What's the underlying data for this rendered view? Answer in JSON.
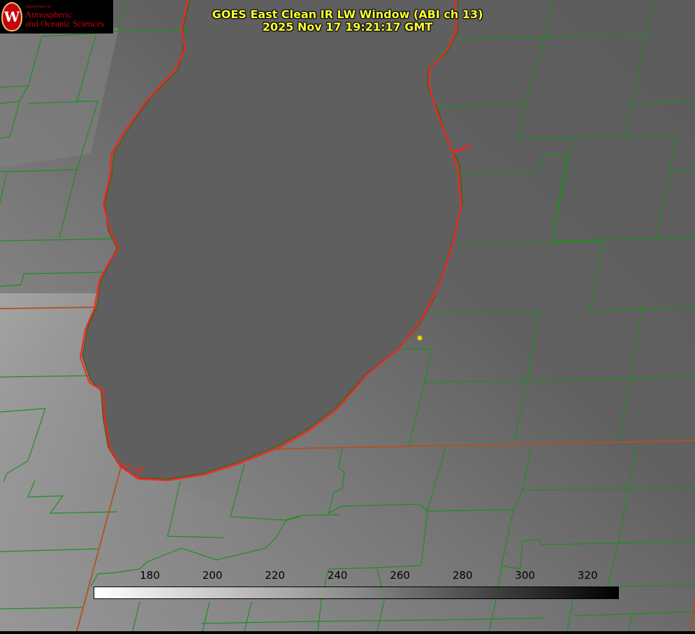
{
  "title": {
    "line1": "GOES East Clean IR LW Window (ABI ch 13)",
    "line2": "2025 Nov 17 19:21:17 GMT"
  },
  "logo": {
    "letter": "W",
    "dept": "Department of",
    "line1": "Atmospheric",
    "line2": "and Oceanic Sciences"
  },
  "colorbar": {
    "ticks": [
      "180",
      "200",
      "220",
      "240",
      "260",
      "280",
      "300",
      "320"
    ],
    "range": [
      162,
      330
    ],
    "start_color": "#ffffff",
    "end_color": "#000000"
  },
  "colors": {
    "county_lines": "#1e8f1e",
    "state_lines": "#b4501e",
    "shoreline": "#ff2020",
    "marker": "#e6d200",
    "title": "#ffff33"
  }
}
